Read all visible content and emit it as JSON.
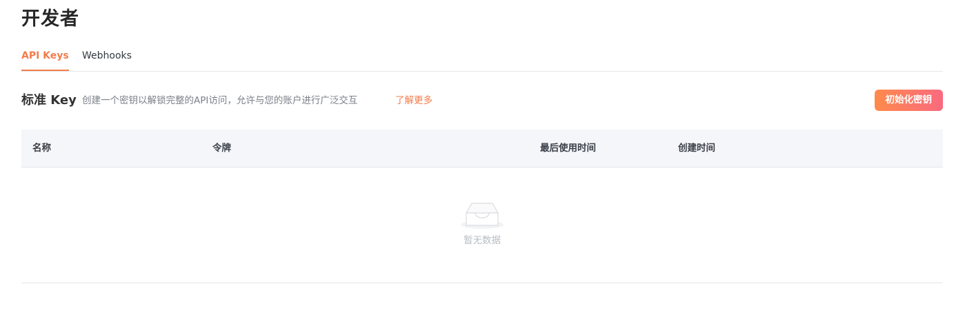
{
  "page": {
    "title": "开发者"
  },
  "tabs": [
    {
      "label": "API Keys",
      "active": true
    },
    {
      "label": "Webhooks",
      "active": false
    }
  ],
  "section": {
    "title": "标准 Key",
    "description": "创建一个密钥以解锁完整的API访问，允许与您的账户进行广泛交互",
    "learn_more": "了解更多",
    "init_button": "初始化密钥"
  },
  "table": {
    "columns": [
      "名称",
      "令牌",
      "最后使用时间",
      "创建时间"
    ],
    "rows": [],
    "empty_text": "暂无数据",
    "empty_icon": "empty-inbox-icon"
  },
  "colors": {
    "accent": "#f27c4a",
    "button_gradient_start": "#ff8a4c",
    "button_gradient_end": "#fa6a7f",
    "table_header_bg": "#f5f6fa"
  }
}
